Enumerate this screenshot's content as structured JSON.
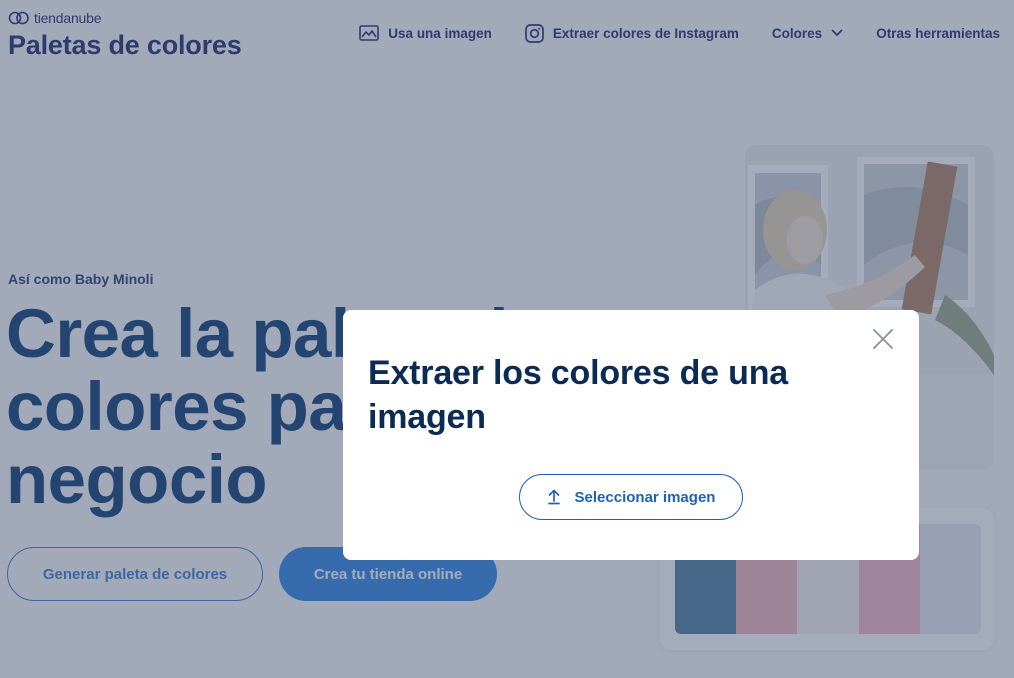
{
  "brand": {
    "name": "tiendanube",
    "title": "Paletas de colores"
  },
  "nav": {
    "use_image": "Usa una imagen",
    "instagram": "Extraer colores de Instagram",
    "colors": "Colores",
    "other_tools": "Otras herramientas"
  },
  "hero": {
    "eyebrow": "Así como Baby Minoli",
    "title": "Crea la paleta de colores para tu negocio",
    "btn_generate": "Generar paleta de colores",
    "btn_store": "Crea tu tienda online"
  },
  "palette": {
    "swatch_colors": [
      "#4f7fa4",
      "#f2b7bc",
      "#f7f1ee",
      "#f4b6c3",
      "#e6ebf2"
    ]
  },
  "modal": {
    "title": "Extraer los colores de una imagen",
    "select_button": "Seleccionar imagen"
  },
  "colors": {
    "brand_navy": "#1d2a6b",
    "primary_blue": "#2c86e8",
    "modal_title": "#0b2b55",
    "link_blue": "#1c62b8"
  }
}
